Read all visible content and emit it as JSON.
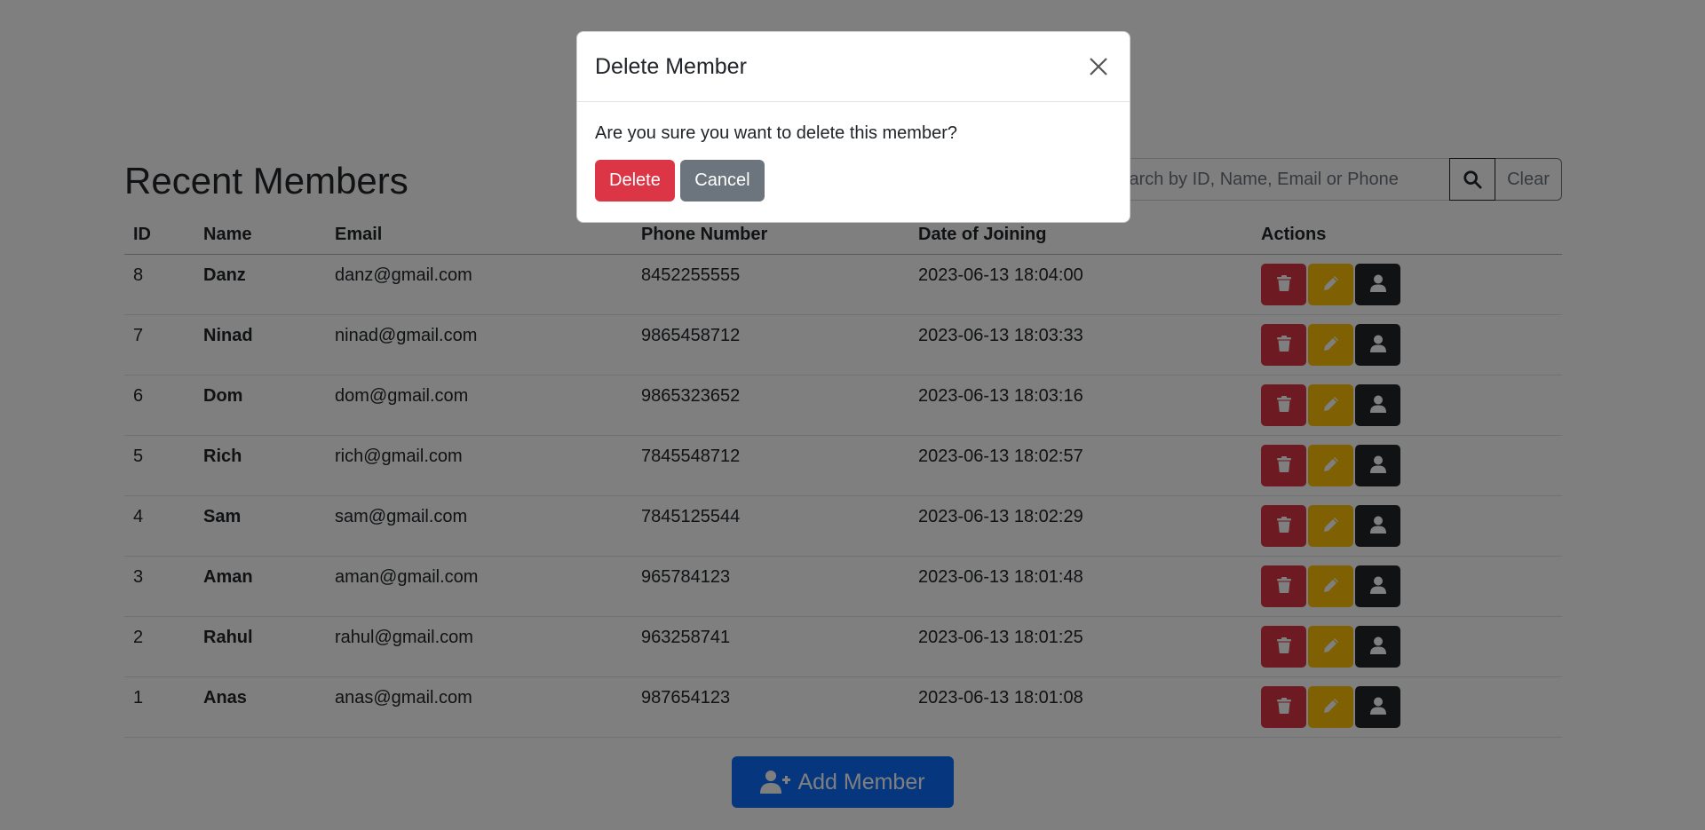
{
  "page": {
    "title": "Recent Members",
    "search_placeholder": "Search by ID, Name, Email or Phone",
    "search_icon": "search-icon",
    "clear_label": "Clear",
    "add_member_label": "Add Member",
    "add_member_icon": "user-plus-icon"
  },
  "table": {
    "headers": [
      "ID",
      "Name",
      "Email",
      "Phone Number",
      "Date of Joining",
      "Actions"
    ],
    "rows": [
      {
        "id": "8",
        "name": "Danz",
        "email": "danz@gmail.com",
        "phone": "8452255555",
        "date": "2023-06-13 18:04:00"
      },
      {
        "id": "7",
        "name": "Ninad",
        "email": "ninad@gmail.com",
        "phone": "9865458712",
        "date": "2023-06-13 18:03:33"
      },
      {
        "id": "6",
        "name": "Dom",
        "email": "dom@gmail.com",
        "phone": "9865323652",
        "date": "2023-06-13 18:03:16"
      },
      {
        "id": "5",
        "name": "Rich",
        "email": "rich@gmail.com",
        "phone": "7845548712",
        "date": "2023-06-13 18:02:57"
      },
      {
        "id": "4",
        "name": "Sam",
        "email": "sam@gmail.com",
        "phone": "7845125544",
        "date": "2023-06-13 18:02:29"
      },
      {
        "id": "3",
        "name": "Aman",
        "email": "aman@gmail.com",
        "phone": "965784123",
        "date": "2023-06-13 18:01:48"
      },
      {
        "id": "2",
        "name": "Rahul",
        "email": "rahul@gmail.com",
        "phone": "963258741",
        "date": "2023-06-13 18:01:25"
      },
      {
        "id": "1",
        "name": "Anas",
        "email": "anas@gmail.com",
        "phone": "987654123",
        "date": "2023-06-13 18:01:08"
      }
    ],
    "action_icons": [
      "trash-icon",
      "pencil-icon",
      "user-icon"
    ]
  },
  "modal": {
    "title": "Delete Member",
    "message": "Are you sure you want to delete this member?",
    "confirm_label": "Delete",
    "cancel_label": "Cancel",
    "close_icon": "close-icon"
  },
  "colors": {
    "danger": "#dc3545",
    "warning": "#ffc107",
    "dark": "#212529",
    "primary": "#0d6efd",
    "secondary": "#6c757d",
    "backdrop": "rgba(0,0,0,0.5)"
  }
}
